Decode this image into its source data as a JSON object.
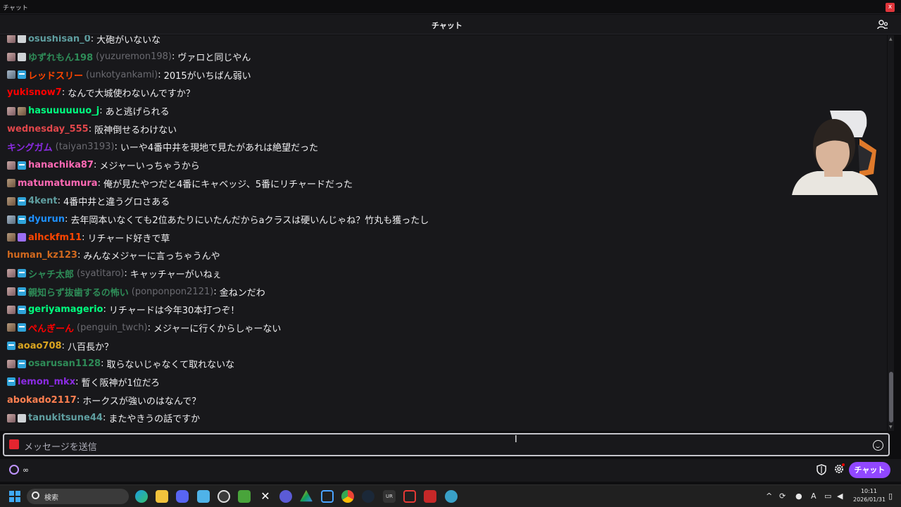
{
  "window": {
    "title": "チャット",
    "close_label": "x"
  },
  "header": {
    "title": "チャット"
  },
  "messages": [
    {
      "badges": [
        "sub",
        "gray"
      ],
      "user": "osushisan_0",
      "color": "#5f9ea0",
      "display": "",
      "text": "大砲がいないな"
    },
    {
      "badges": [
        "sub",
        "gray"
      ],
      "user": "ゆずれもん198",
      "color": "#2e8b57",
      "display": "(yuzuremon198)",
      "text": "ヴァロと同じやん"
    },
    {
      "badges": [
        "sub2",
        "prime"
      ],
      "user": "レッドスリー",
      "color": "#ff4500",
      "display": "(unkotyankami)",
      "text": "2015がいちばん弱い"
    },
    {
      "badges": [],
      "user": "yukisnow7",
      "color": "#ff0000",
      "display": "",
      "text": "なんで大城使わないんですか？"
    },
    {
      "badges": [
        "sub",
        "sub3"
      ],
      "user": "hasuuuuuuo_j",
      "color": "#00ff7f",
      "display": "",
      "text": "あと逃げられる"
    },
    {
      "badges": [],
      "user": "wednesday_555",
      "color": "#e0464a",
      "display": "",
      "text": "阪神倒せるわけない"
    },
    {
      "badges": [],
      "user": "キングガム",
      "color": "#8a2be2",
      "display": "(taiyan3193)",
      "text": "いーや4番中井を現地で見たがあれは絶望だった"
    },
    {
      "badges": [
        "sub",
        "prime"
      ],
      "user": "hanachika87",
      "color": "#ff69b4",
      "display": "",
      "text": "メジャーいっちゃうから"
    },
    {
      "badges": [
        "sub3"
      ],
      "user": "matumatumura",
      "color": "#ff69b4",
      "display": "",
      "text": "俺が見たやつだと4番にキャベッジ、5番にリチャードだった"
    },
    {
      "badges": [
        "sub3",
        "prime"
      ],
      "user": "4kent",
      "color": "#5f9ea0",
      "display": "",
      "text": "4番中井と違うグロさある"
    },
    {
      "badges": [
        "sub2",
        "prime"
      ],
      "user": "dyurun",
      "color": "#1e90ff",
      "display": "",
      "text": "去年岡本いなくても2位あたりにいたんだからaクラスは硬いんじゃね？竹丸も獲ったし"
    },
    {
      "badges": [
        "sub3",
        "star"
      ],
      "user": "alhckfm11",
      "color": "#ff4500",
      "display": "",
      "text": "リチャード好きで草"
    },
    {
      "badges": [],
      "user": "human_kz123",
      "color": "#d2691e",
      "display": "",
      "text": "みんなメジャーに言っちゃうんや"
    },
    {
      "badges": [
        "sub",
        "prime"
      ],
      "user": "シャチ太郎",
      "color": "#2e8b57",
      "display": "(syatitaro)",
      "text": "キャッチャーがいねぇ"
    },
    {
      "badges": [
        "sub",
        "prime"
      ],
      "user": "親知らず抜歯するの怖い",
      "color": "#2e8b57",
      "display": "(ponponpon2121)",
      "text": "金ねンだわ"
    },
    {
      "badges": [
        "sub",
        "prime"
      ],
      "user": "geriyamagerio",
      "color": "#00ff7f",
      "display": "",
      "text": "リチャードは今年30本打つぞ！"
    },
    {
      "badges": [
        "sub3",
        "prime"
      ],
      "user": "ぺんぎーん",
      "color": "#ff0000",
      "display": "(penguin_twch)",
      "text": "メジャーに行くからしゃーない"
    },
    {
      "badges": [
        "prime"
      ],
      "user": "aoao708",
      "color": "#daa520",
      "display": "",
      "text": "八百長か？"
    },
    {
      "badges": [
        "sub",
        "prime"
      ],
      "user": "osarusan1128",
      "color": "#2e8b57",
      "display": "",
      "text": "取らないじゃなくて取れないな"
    },
    {
      "badges": [
        "prime"
      ],
      "user": "lemon_mkx",
      "color": "#8a2be2",
      "display": "",
      "text": "暫く阪神が1位だろ"
    },
    {
      "badges": [],
      "user": "abokado2117",
      "color": "#ff7f50",
      "display": "",
      "text": "ホークスが強いのはなんで？"
    },
    {
      "badges": [
        "sub",
        "gray"
      ],
      "user": "tanukitsune44",
      "color": "#5f9ea0",
      "display": "",
      "text": "またやきうの話ですか"
    }
  ],
  "input": {
    "placeholder": "メッセージを送信"
  },
  "bottom": {
    "points": "∞",
    "chat_button": "チャット"
  },
  "taskbar": {
    "search_placeholder": "検索",
    "time": "10:11",
    "date": "2026/01/31",
    "ime": "A"
  }
}
